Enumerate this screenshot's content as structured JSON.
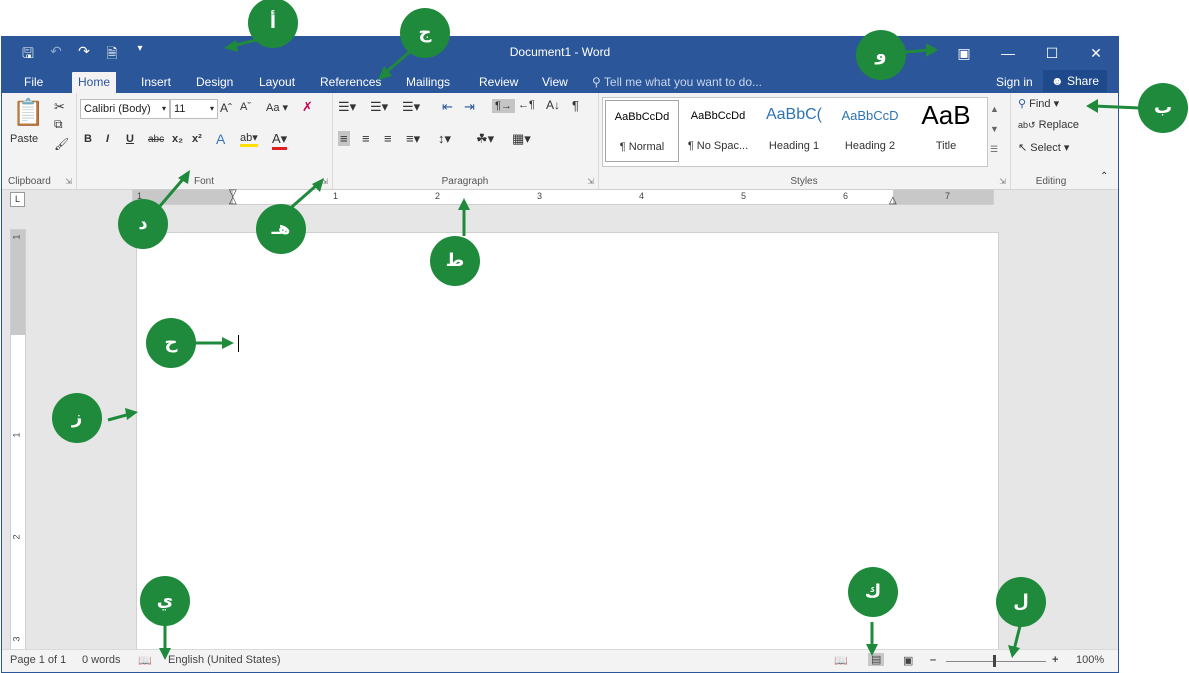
{
  "window": {
    "title": "Document1 - Word",
    "quick_access": [
      "save-icon",
      "undo-icon",
      "redo-icon",
      "new-document-icon",
      "customize-dropdown-icon"
    ],
    "controls": [
      "ribbon-display-options-icon",
      "minimize-icon",
      "maximize-icon",
      "close-icon"
    ]
  },
  "tabs": [
    {
      "label": "File",
      "active": false
    },
    {
      "label": "Home",
      "active": true
    },
    {
      "label": "Insert",
      "active": false
    },
    {
      "label": "Design",
      "active": false
    },
    {
      "label": "Layout",
      "active": false
    },
    {
      "label": "References",
      "active": false
    },
    {
      "label": "Mailings",
      "active": false
    },
    {
      "label": "Review",
      "active": false
    },
    {
      "label": "View",
      "active": false
    }
  ],
  "tell_me": "Tell me what you want to do...",
  "account": {
    "sign_in": "Sign in",
    "share": "Share"
  },
  "ribbon": {
    "clipboard": {
      "label": "Clipboard",
      "paste": "Paste"
    },
    "font": {
      "label": "Font",
      "family": "Calibri (Body)",
      "size": "11",
      "change_case": "Aa"
    },
    "paragraph": {
      "label": "Paragraph"
    },
    "styles": {
      "label": "Styles",
      "items": [
        {
          "preview": "AaBbCcDd",
          "name": "¶ Normal"
        },
        {
          "preview": "AaBbCcDd",
          "name": "¶ No Spac..."
        },
        {
          "preview": "AaBbC(",
          "name": "Heading 1"
        },
        {
          "preview": "AaBbCcD",
          "name": "Heading 2"
        },
        {
          "preview": "AaB",
          "name": "Title"
        }
      ]
    },
    "editing": {
      "label": "Editing",
      "find": "Find",
      "replace": "Replace",
      "select": "Select"
    }
  },
  "ruler": {
    "numbers": [
      "1",
      "1",
      "2",
      "3",
      "4",
      "5",
      "6",
      "7"
    ]
  },
  "vruler": {
    "numbers": [
      "1",
      "1",
      "2",
      "3"
    ]
  },
  "status": {
    "page": "Page 1 of 1",
    "words": "0 words",
    "language": "English (United States)",
    "zoom": "100%",
    "zoom_fraction": 0.5
  },
  "callouts": {
    "a": "أ",
    "b": "ب",
    "j": "ج",
    "d": "د",
    "h": "هـ",
    "w": "و",
    "z": "ز",
    "hh": "ح",
    "t": "ط",
    "y": "ي",
    "k": "ك",
    "l": "ل"
  },
  "colors": {
    "brand": "#2b579a",
    "callout": "#1f8a3b"
  }
}
